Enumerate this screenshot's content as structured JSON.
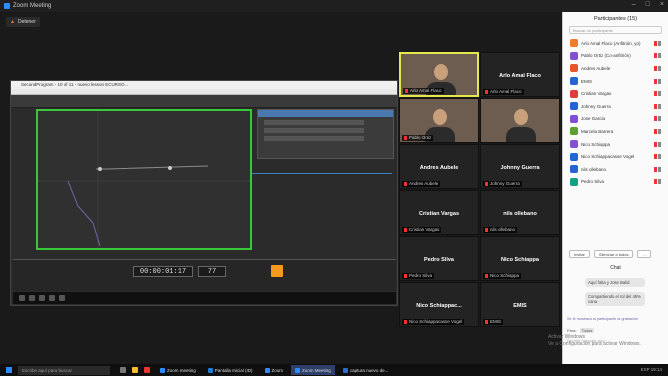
{
  "window": {
    "title": "Zoom Meeting"
  },
  "share_label": "Detener",
  "shared_app": {
    "title": "SecondProgram - 10 of 11 - nuevo lesson ECURSO...",
    "timecode": "00:00:01:17",
    "frame": "77"
  },
  "tiles": [
    {
      "name": "",
      "label": "Arlo Amal Flaco",
      "video": true,
      "active": true
    },
    {
      "name": "Arlo Amal Flaco",
      "label": "Arlo Amal Flaco",
      "video": false
    },
    {
      "name": "",
      "label": "Pablo Ortiz",
      "video": true
    },
    {
      "name": "",
      "label": "",
      "video": true
    },
    {
      "name": "Andres Aubele",
      "label": "Andres Aubele",
      "video": false
    },
    {
      "name": "Johnny Guerra",
      "label": "Johnny Guerra",
      "video": false
    },
    {
      "name": "Cristian Vargas",
      "label": "Cristian Vargas",
      "video": false
    },
    {
      "name": "nils ollebano",
      "label": "nils ollebano",
      "video": false
    },
    {
      "name": "Pedro Silva",
      "label": "Pedro Silva",
      "video": false
    },
    {
      "name": "Nico Schiappa",
      "label": "Nico Schiappa",
      "video": false
    },
    {
      "name": "Nico Schiappac...",
      "label": "Nico Schiappacasse Vogel",
      "video": false
    },
    {
      "name": "EMIS",
      "label": "EMIS",
      "video": false
    }
  ],
  "sidebar": {
    "title": "Participantes (15)",
    "search_placeholder": "Buscar un participante",
    "participants": [
      {
        "name": "Arlo Amal Flaco (Anfitrión, yo)",
        "color": "#f07d2a"
      },
      {
        "name": "Pablo Ortiz (Co-anfitrión)",
        "color": "#7f4fd8"
      },
      {
        "name": "Andres Aubele",
        "color": "#e8552d"
      },
      {
        "name": "EMIS",
        "color": "#2166d2"
      },
      {
        "name": "Cristian Vargas",
        "color": "#e03c3c"
      },
      {
        "name": "Johnny Guerra",
        "color": "#2166d2"
      },
      {
        "name": "Jose Garcia",
        "color": "#7f4fd8"
      },
      {
        "name": "Marcela Barrera",
        "color": "#5aa033"
      },
      {
        "name": "Nico Schiappa",
        "color": "#7f4fd8"
      },
      {
        "name": "Nico Schiappacasse Vogel",
        "color": "#2166d2"
      },
      {
        "name": "nils ollebano",
        "color": "#2166d2"
      },
      {
        "name": "Pedro Silva",
        "color": "#16a082"
      }
    ],
    "invite_label": "Invitar",
    "mute_all_label": "Silenciar a todos",
    "more_label": "...",
    "chat_title": "Chat",
    "messages": [
      "Aquí falta y Jose Balid",
      "Compartiendo el rol del 45% cana"
    ],
    "note": "Se le mostrará al participante la grabación",
    "to_label": "Para:",
    "to_value": "Todos",
    "input_placeholder": "Escribir mensaje aquí..."
  },
  "watermark": [
    "Activar Windows",
    "Ve a Configuración para activar Windows."
  ],
  "taskbar": {
    "search_placeholder": "Escribe aquí para buscar",
    "apps": [
      "Zoom meeting",
      "Pantalla Inicial (ID)",
      "Zoom",
      "Zoom Meeting",
      "captura nuevo de..."
    ],
    "tray": "ESP 19:14"
  }
}
